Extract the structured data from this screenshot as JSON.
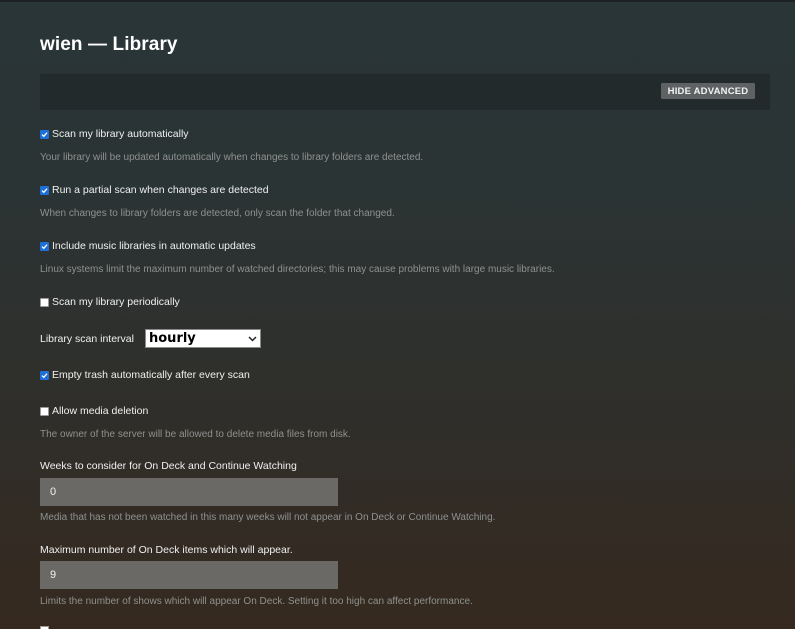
{
  "page": {
    "title": "wien — Library"
  },
  "toolbar": {
    "advanced_button_label": "HIDE ADVANCED"
  },
  "settings": {
    "scan_auto": {
      "label": "Scan my library automatically",
      "checked": true,
      "help": "Your library will be updated automatically when changes to library folders are detected."
    },
    "partial_scan": {
      "label": "Run a partial scan when changes are detected",
      "checked": true,
      "help": "When changes to library folders are detected, only scan the folder that changed."
    },
    "music_updates": {
      "label": "Include music libraries in automatic updates",
      "checked": true,
      "help": "Linux systems limit the maximum number of watched directories; this may cause problems with large music libraries."
    },
    "scan_periodic": {
      "label": "Scan my library periodically",
      "checked": false
    },
    "scan_interval": {
      "label": "Library scan interval",
      "value": "hourly"
    },
    "empty_trash": {
      "label": "Empty trash automatically after every scan",
      "checked": true
    },
    "media_deletion": {
      "label": "Allow media deletion",
      "checked": false,
      "help": "The owner of the server will be allowed to delete media files from disk."
    },
    "weeks_on_deck": {
      "label": "Weeks to consider for On Deck and Continue Watching",
      "value": "0",
      "help": "Media that has not been watched in this many weeks will not appear in On Deck or Continue Watching."
    },
    "max_on_deck": {
      "label": "Maximum number of On Deck items which will appear.",
      "value": "9",
      "help": "Limits the number of shows which will appear On Deck. Setting it too high can affect performance."
    }
  },
  "colors": {
    "checkbox_checked": "#1f6fd6",
    "input_bg": "#6b6966",
    "help_text": "#8e918f"
  },
  "icons": {
    "checkbox_check": "check-icon",
    "select_arrow": "chevron-down-icon"
  }
}
